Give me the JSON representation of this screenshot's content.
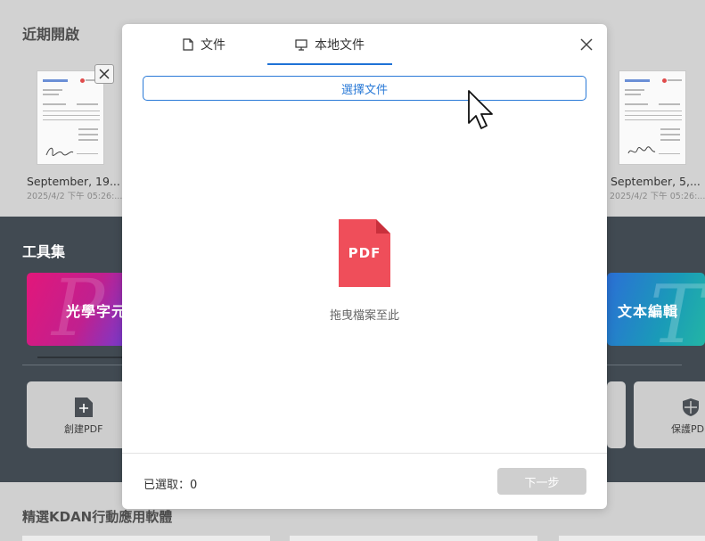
{
  "recent": {
    "title": "近期開啟",
    "files": [
      {
        "name": "September, 19...",
        "date": "2025/4/2 下午 05:26:..."
      },
      {
        "name": "September, 5,...",
        "date": "2025/4/2 下午 05:26:..."
      }
    ]
  },
  "tools": {
    "title": "工具集",
    "cards": [
      "光學字元",
      "文本編輯"
    ],
    "small_cards": [
      "創建PDF",
      "保護PDF"
    ]
  },
  "bottom": {
    "title": "精選KDAN行動應用軟體"
  },
  "modal": {
    "tabs": [
      {
        "label": "文件",
        "icon": "document-icon",
        "active": false
      },
      {
        "label": "本地文件",
        "icon": "monitor-icon",
        "active": true
      }
    ],
    "choose_button": "選擇文件",
    "pdf_icon_label": "PDF",
    "drop_text": "拖曳檔案至此",
    "selected_count": "已選取：0",
    "next_button": "下一步"
  },
  "colors": {
    "accent": "#1f72d6",
    "pdf_red": "#ef4e5a",
    "tools_band": "#414a52",
    "disabled_button": "#cfcfcf"
  }
}
